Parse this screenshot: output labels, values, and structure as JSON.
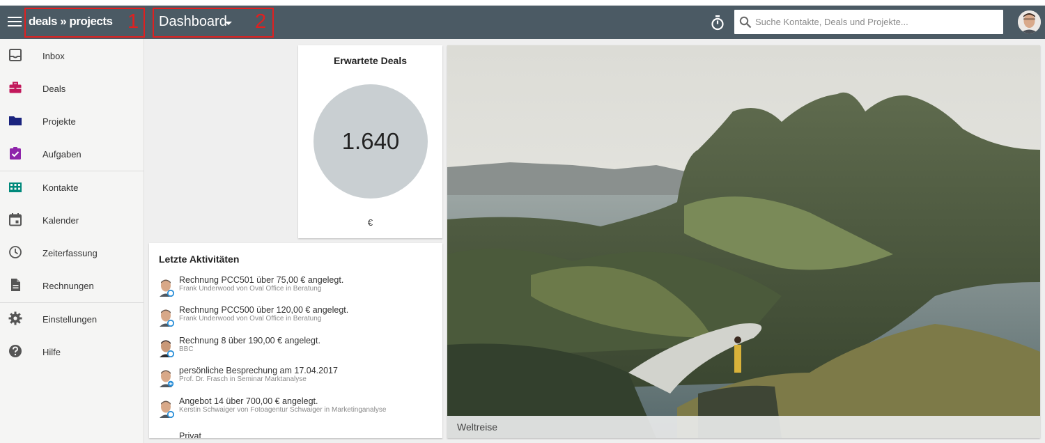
{
  "header": {
    "brand": "deals » projects",
    "brand_marker": "1",
    "view_title": "Dashboard",
    "view_marker": "2",
    "search_placeholder": "Suche Kontakte, Deals und Projekte...",
    "icons": [
      "menu-icon",
      "timer-icon",
      "search-icon",
      "user-avatar"
    ]
  },
  "sidebar": {
    "items": [
      {
        "label": "Inbox",
        "icon": "inbox-icon",
        "color": "#555555"
      },
      {
        "label": "Deals",
        "icon": "briefcase-icon",
        "color": "#c2185b"
      },
      {
        "label": "Projekte",
        "icon": "folder-icon",
        "color": "#1a237e"
      },
      {
        "label": "Aufgaben",
        "icon": "task-check-icon",
        "color": "#8e24aa"
      },
      {
        "label": "Kontakte",
        "icon": "contacts-grid-icon",
        "color": "#00897b"
      },
      {
        "label": "Kalender",
        "icon": "calendar-icon",
        "color": "#555555"
      },
      {
        "label": "Zeiterfassung",
        "icon": "clock-icon",
        "color": "#555555"
      },
      {
        "label": "Rechnungen",
        "icon": "document-icon",
        "color": "#555555"
      },
      {
        "label": "Einstellungen",
        "icon": "gear-icon",
        "color": "#555555"
      },
      {
        "label": "Hilfe",
        "icon": "help-icon",
        "color": "#555555"
      }
    ]
  },
  "deals_widget": {
    "title": "Erwartete Deals",
    "value": "1.640",
    "unit": "€"
  },
  "activities": {
    "title": "Letzte Aktivitäten",
    "items": [
      {
        "text": "Rechnung PCC501 über 75,00 € angelegt.",
        "sub": "Frank Underwood von Oval Office in Beratung"
      },
      {
        "text": "Rechnung PCC500 über 120,00 € angelegt.",
        "sub": "Frank Underwood von Oval Office in Beratung"
      },
      {
        "text": "Rechnung 8 über 190,00 € angelegt.",
        "sub": "BBC"
      },
      {
        "text": "persönliche Besprechung am 17.04.2017",
        "sub": "Prof. Dr. Frasch in Seminar Marktanalyse"
      },
      {
        "text": "Angebot 14 über 700,00 € angelegt.",
        "sub": "Kerstin Schwaiger von Fotoagentur Schwaiger in Marketinganalyse"
      },
      {
        "text": "Privat",
        "sub": ""
      }
    ]
  },
  "photo_widget": {
    "caption": "Weltreise"
  },
  "colors": {
    "topbar": "#4b5a64",
    "annotation": "#e02020",
    "deals_circle": "#c9cfd2"
  }
}
